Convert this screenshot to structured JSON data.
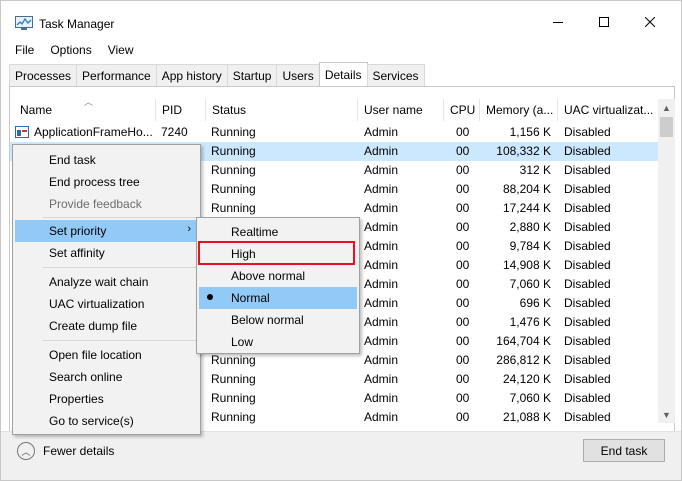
{
  "window": {
    "title": "Task Manager"
  },
  "menubar": [
    "File",
    "Options",
    "View"
  ],
  "tabs": [
    {
      "label": "Processes",
      "active": false
    },
    {
      "label": "Performance",
      "active": false
    },
    {
      "label": "App history",
      "active": false
    },
    {
      "label": "Startup",
      "active": false
    },
    {
      "label": "Users",
      "active": false
    },
    {
      "label": "Details",
      "active": true
    },
    {
      "label": "Services",
      "active": false
    }
  ],
  "columns": [
    "Name",
    "PID",
    "Status",
    "User name",
    "CPU",
    "Memory (a...",
    "UAC virtualizat..."
  ],
  "rows": [
    {
      "name": "ApplicationFrameHo...",
      "pid": "7240",
      "status": "Running",
      "user": "Admin",
      "cpu": "00",
      "memory": "1,156 K",
      "uac": "Disabled",
      "selected": false
    },
    {
      "name": "",
      "pid": "",
      "status": "Running",
      "user": "Admin",
      "cpu": "00",
      "memory": "108,332 K",
      "uac": "Disabled",
      "selected": true
    },
    {
      "name": "",
      "pid": "",
      "status": "Running",
      "user": "Admin",
      "cpu": "00",
      "memory": "312 K",
      "uac": "Disabled",
      "selected": false
    },
    {
      "name": "",
      "pid": "",
      "status": "Running",
      "user": "Admin",
      "cpu": "00",
      "memory": "88,204 K",
      "uac": "Disabled",
      "selected": false
    },
    {
      "name": "",
      "pid": "",
      "status": "Running",
      "user": "Admin",
      "cpu": "00",
      "memory": "17,244 K",
      "uac": "Disabled",
      "selected": false
    },
    {
      "name": "",
      "pid": "",
      "status": "",
      "user": "Admin",
      "cpu": "00",
      "memory": "2,880 K",
      "uac": "Disabled",
      "selected": false
    },
    {
      "name": "",
      "pid": "",
      "status": "",
      "user": "Admin",
      "cpu": "00",
      "memory": "9,784 K",
      "uac": "Disabled",
      "selected": false
    },
    {
      "name": "",
      "pid": "",
      "status": "",
      "user": "Admin",
      "cpu": "00",
      "memory": "14,908 K",
      "uac": "Disabled",
      "selected": false
    },
    {
      "name": "",
      "pid": "",
      "status": "",
      "user": "Admin",
      "cpu": "00",
      "memory": "7,060 K",
      "uac": "Disabled",
      "selected": false
    },
    {
      "name": "",
      "pid": "",
      "status": "",
      "user": "Admin",
      "cpu": "00",
      "memory": "696 K",
      "uac": "Disabled",
      "selected": false
    },
    {
      "name": "",
      "pid": "",
      "status": "",
      "user": "Admin",
      "cpu": "00",
      "memory": "1,476 K",
      "uac": "Disabled",
      "selected": false
    },
    {
      "name": "",
      "pid": "",
      "status": "",
      "user": "Admin",
      "cpu": "00",
      "memory": "164,704 K",
      "uac": "Disabled",
      "selected": false
    },
    {
      "name": "",
      "pid": "",
      "status": "Running",
      "user": "Admin",
      "cpu": "00",
      "memory": "286,812 K",
      "uac": "Disabled",
      "selected": false
    },
    {
      "name": "",
      "pid": "",
      "status": "Running",
      "user": "Admin",
      "cpu": "00",
      "memory": "24,120 K",
      "uac": "Disabled",
      "selected": false
    },
    {
      "name": "",
      "pid": "",
      "status": "Running",
      "user": "Admin",
      "cpu": "00",
      "memory": "7,060 K",
      "uac": "Disabled",
      "selected": false
    },
    {
      "name": "",
      "pid": "",
      "status": "Running",
      "user": "Admin",
      "cpu": "00",
      "memory": "21,088 K",
      "uac": "Disabled",
      "selected": false
    }
  ],
  "context_menu": {
    "items": [
      {
        "label": "End task",
        "disabled": false
      },
      {
        "label": "End process tree",
        "disabled": false
      },
      {
        "label": "Provide feedback",
        "disabled": true
      },
      {
        "label": "Set priority",
        "disabled": false,
        "submenu": true
      },
      {
        "label": "Set affinity",
        "disabled": false
      },
      {
        "label": "Analyze wait chain",
        "disabled": false
      },
      {
        "label": "UAC virtualization",
        "disabled": false
      },
      {
        "label": "Create dump file",
        "disabled": false
      },
      {
        "label": "Open file location",
        "disabled": false
      },
      {
        "label": "Search online",
        "disabled": false
      },
      {
        "label": "Properties",
        "disabled": false
      },
      {
        "label": "Go to service(s)",
        "disabled": false
      }
    ]
  },
  "priority_submenu": {
    "items": [
      "Realtime",
      "High",
      "Above normal",
      "Normal",
      "Below normal",
      "Low"
    ],
    "current": "Normal",
    "highlighted": "High"
  },
  "footer": {
    "fewer_details": "Fewer details",
    "end_task": "End task"
  },
  "colors": {
    "selection": "#cce8ff",
    "menu_hover": "#91c9f7",
    "highlight_box": "#e81123"
  }
}
